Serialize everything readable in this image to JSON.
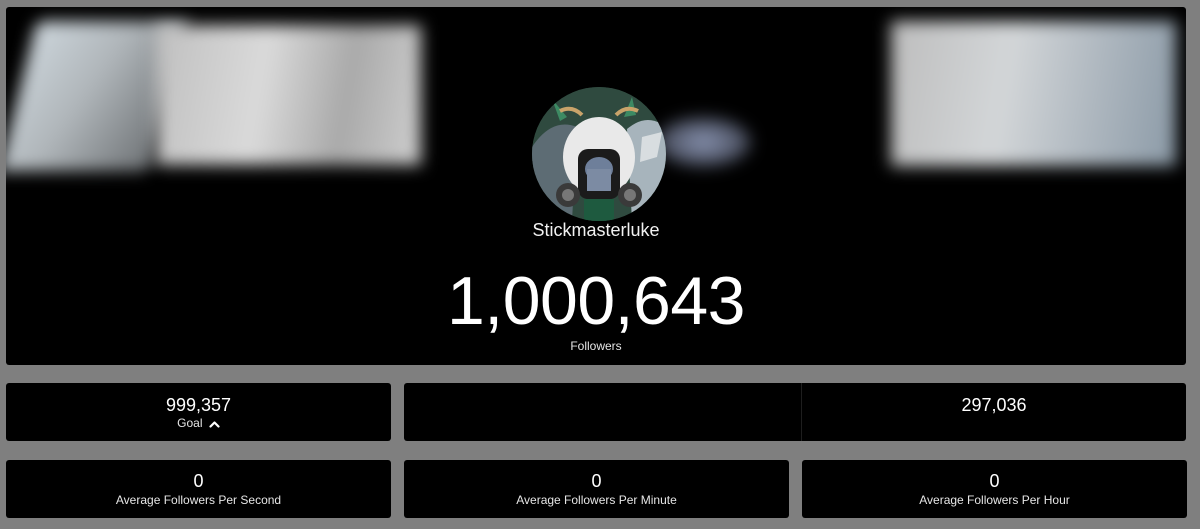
{
  "profile": {
    "username": "Stickmasterluke",
    "follower_count": "1,000,643",
    "followers_label": "Followers"
  },
  "stats": {
    "goal": {
      "value": "999,357",
      "label": "Goal"
    },
    "middle_right": {
      "value": "297,036"
    },
    "avg_per_second": {
      "value": "0",
      "label": "Average Followers Per Second"
    },
    "avg_per_minute": {
      "value": "0",
      "label": "Average Followers Per Minute"
    },
    "avg_per_hour": {
      "value": "0",
      "label": "Average Followers Per Hour"
    }
  },
  "icons": {
    "goal_toggle": "chevron-up-icon"
  },
  "colors": {
    "page_background": "#7f7f7f",
    "panel_background": "#000000",
    "text": "#ffffff"
  }
}
